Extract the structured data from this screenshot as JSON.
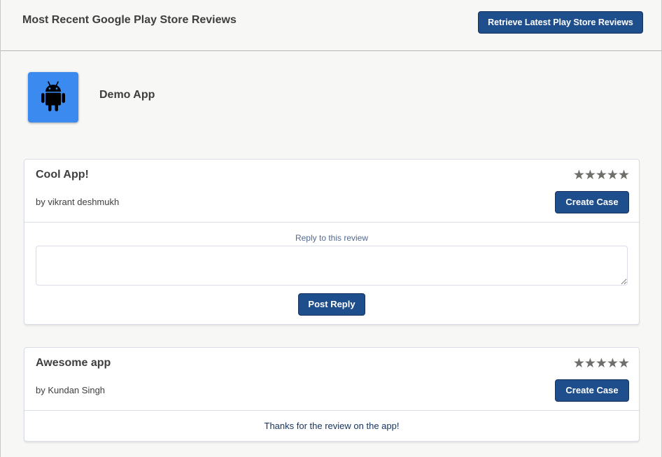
{
  "header": {
    "title": "Most Recent Google Play Store Reviews",
    "retrieve_label": "Retrieve Latest Play Store Reviews"
  },
  "app": {
    "name": "Demo App",
    "icon": "android-icon"
  },
  "reviews": [
    {
      "title": "Cool App!",
      "author": "by vikrant deshmukh",
      "stars": "★★★★★",
      "create_case_label": "Create Case",
      "reply_label": "Reply to this review",
      "reply_value": "",
      "post_reply_label": "Post Reply"
    },
    {
      "title": "Awesome app",
      "author": "by Kundan Singh",
      "stars": "★★★★★",
      "create_case_label": "Create Case",
      "reply_text": "Thanks for the review on the app!"
    }
  ],
  "colors": {
    "brand_button": "#1f4e8c",
    "app_icon_bg": "#3a8af0",
    "star_color": "#706e6b"
  }
}
